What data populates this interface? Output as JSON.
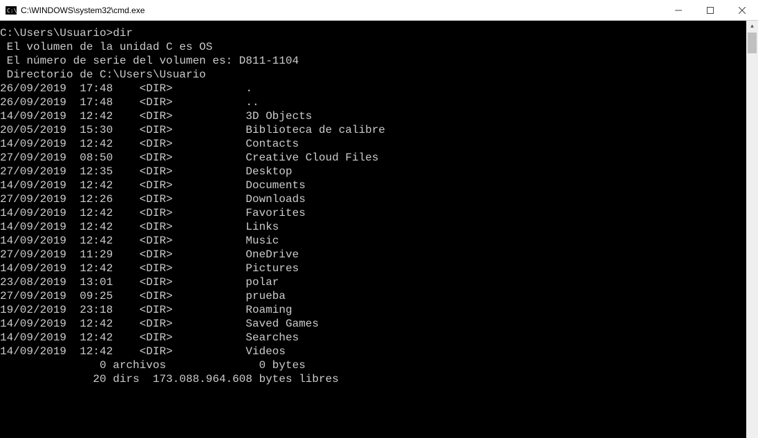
{
  "titlebar": {
    "title": "C:\\WINDOWS\\system32\\cmd.exe"
  },
  "console": {
    "prompt": "C:\\Users\\Usuario>",
    "command": "dir",
    "volume_line": " El volumen de la unidad C es OS",
    "serial_line": " El número de serie del volumen es: D811-1104",
    "directory_line": " Directorio de C:\\Users\\Usuario",
    "entries": [
      {
        "date": "26/09/2019",
        "time": "17:48",
        "type": "<DIR>",
        "name": "."
      },
      {
        "date": "26/09/2019",
        "time": "17:48",
        "type": "<DIR>",
        "name": ".."
      },
      {
        "date": "14/09/2019",
        "time": "12:42",
        "type": "<DIR>",
        "name": "3D Objects"
      },
      {
        "date": "20/05/2019",
        "time": "15:30",
        "type": "<DIR>",
        "name": "Biblioteca de calibre"
      },
      {
        "date": "14/09/2019",
        "time": "12:42",
        "type": "<DIR>",
        "name": "Contacts"
      },
      {
        "date": "27/09/2019",
        "time": "08:50",
        "type": "<DIR>",
        "name": "Creative Cloud Files"
      },
      {
        "date": "27/09/2019",
        "time": "12:35",
        "type": "<DIR>",
        "name": "Desktop"
      },
      {
        "date": "14/09/2019",
        "time": "12:42",
        "type": "<DIR>",
        "name": "Documents"
      },
      {
        "date": "27/09/2019",
        "time": "12:26",
        "type": "<DIR>",
        "name": "Downloads"
      },
      {
        "date": "14/09/2019",
        "time": "12:42",
        "type": "<DIR>",
        "name": "Favorites"
      },
      {
        "date": "14/09/2019",
        "time": "12:42",
        "type": "<DIR>",
        "name": "Links"
      },
      {
        "date": "14/09/2019",
        "time": "12:42",
        "type": "<DIR>",
        "name": "Music"
      },
      {
        "date": "27/09/2019",
        "time": "11:29",
        "type": "<DIR>",
        "name": "OneDrive"
      },
      {
        "date": "14/09/2019",
        "time": "12:42",
        "type": "<DIR>",
        "name": "Pictures"
      },
      {
        "date": "23/08/2019",
        "time": "13:01",
        "type": "<DIR>",
        "name": "polar"
      },
      {
        "date": "27/09/2019",
        "time": "09:25",
        "type": "<DIR>",
        "name": "prueba"
      },
      {
        "date": "19/02/2019",
        "time": "23:18",
        "type": "<DIR>",
        "name": "Roaming"
      },
      {
        "date": "14/09/2019",
        "time": "12:42",
        "type": "<DIR>",
        "name": "Saved Games"
      },
      {
        "date": "14/09/2019",
        "time": "12:42",
        "type": "<DIR>",
        "name": "Searches"
      },
      {
        "date": "14/09/2019",
        "time": "12:42",
        "type": "<DIR>",
        "name": "Videos"
      }
    ],
    "summary_files": "               0 archivos              0 bytes",
    "summary_dirs": "              20 dirs  173.088.964.608 bytes libres"
  }
}
